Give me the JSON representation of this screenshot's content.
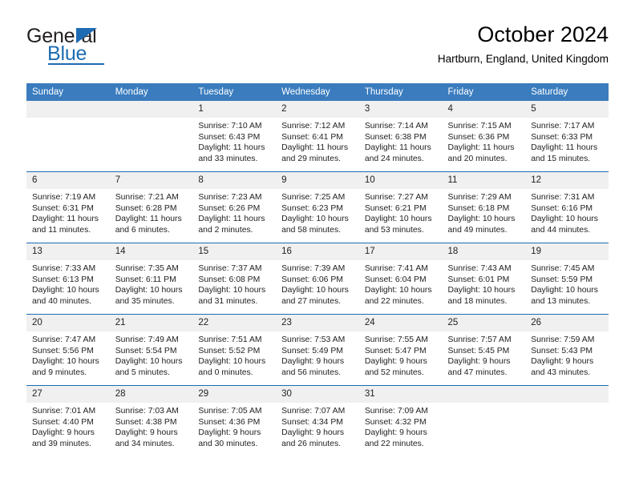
{
  "logo": {
    "text_top": "General",
    "text_bottom": "Blue",
    "accent_color": "#1d6cb3"
  },
  "header": {
    "title": "October 2024",
    "location": "Hartburn, England, United Kingdom"
  },
  "calendar": {
    "header_color": "#3a7cbe",
    "row_divider_color": "#1d6cb3",
    "daynum_background": "#f0f0f0",
    "weekday_headers": [
      "Sunday",
      "Monday",
      "Tuesday",
      "Wednesday",
      "Thursday",
      "Friday",
      "Saturday"
    ],
    "weeks": [
      [
        {
          "day": "",
          "sunrise": "",
          "sunset": "",
          "daylight_line1": "",
          "daylight_line2": ""
        },
        {
          "day": "",
          "sunrise": "",
          "sunset": "",
          "daylight_line1": "",
          "daylight_line2": ""
        },
        {
          "day": "1",
          "sunrise": "Sunrise: 7:10 AM",
          "sunset": "Sunset: 6:43 PM",
          "daylight_line1": "Daylight: 11 hours",
          "daylight_line2": "and 33 minutes."
        },
        {
          "day": "2",
          "sunrise": "Sunrise: 7:12 AM",
          "sunset": "Sunset: 6:41 PM",
          "daylight_line1": "Daylight: 11 hours",
          "daylight_line2": "and 29 minutes."
        },
        {
          "day": "3",
          "sunrise": "Sunrise: 7:14 AM",
          "sunset": "Sunset: 6:38 PM",
          "daylight_line1": "Daylight: 11 hours",
          "daylight_line2": "and 24 minutes."
        },
        {
          "day": "4",
          "sunrise": "Sunrise: 7:15 AM",
          "sunset": "Sunset: 6:36 PM",
          "daylight_line1": "Daylight: 11 hours",
          "daylight_line2": "and 20 minutes."
        },
        {
          "day": "5",
          "sunrise": "Sunrise: 7:17 AM",
          "sunset": "Sunset: 6:33 PM",
          "daylight_line1": "Daylight: 11 hours",
          "daylight_line2": "and 15 minutes."
        }
      ],
      [
        {
          "day": "6",
          "sunrise": "Sunrise: 7:19 AM",
          "sunset": "Sunset: 6:31 PM",
          "daylight_line1": "Daylight: 11 hours",
          "daylight_line2": "and 11 minutes."
        },
        {
          "day": "7",
          "sunrise": "Sunrise: 7:21 AM",
          "sunset": "Sunset: 6:28 PM",
          "daylight_line1": "Daylight: 11 hours",
          "daylight_line2": "and 6 minutes."
        },
        {
          "day": "8",
          "sunrise": "Sunrise: 7:23 AM",
          "sunset": "Sunset: 6:26 PM",
          "daylight_line1": "Daylight: 11 hours",
          "daylight_line2": "and 2 minutes."
        },
        {
          "day": "9",
          "sunrise": "Sunrise: 7:25 AM",
          "sunset": "Sunset: 6:23 PM",
          "daylight_line1": "Daylight: 10 hours",
          "daylight_line2": "and 58 minutes."
        },
        {
          "day": "10",
          "sunrise": "Sunrise: 7:27 AM",
          "sunset": "Sunset: 6:21 PM",
          "daylight_line1": "Daylight: 10 hours",
          "daylight_line2": "and 53 minutes."
        },
        {
          "day": "11",
          "sunrise": "Sunrise: 7:29 AM",
          "sunset": "Sunset: 6:18 PM",
          "daylight_line1": "Daylight: 10 hours",
          "daylight_line2": "and 49 minutes."
        },
        {
          "day": "12",
          "sunrise": "Sunrise: 7:31 AM",
          "sunset": "Sunset: 6:16 PM",
          "daylight_line1": "Daylight: 10 hours",
          "daylight_line2": "and 44 minutes."
        }
      ],
      [
        {
          "day": "13",
          "sunrise": "Sunrise: 7:33 AM",
          "sunset": "Sunset: 6:13 PM",
          "daylight_line1": "Daylight: 10 hours",
          "daylight_line2": "and 40 minutes."
        },
        {
          "day": "14",
          "sunrise": "Sunrise: 7:35 AM",
          "sunset": "Sunset: 6:11 PM",
          "daylight_line1": "Daylight: 10 hours",
          "daylight_line2": "and 35 minutes."
        },
        {
          "day": "15",
          "sunrise": "Sunrise: 7:37 AM",
          "sunset": "Sunset: 6:08 PM",
          "daylight_line1": "Daylight: 10 hours",
          "daylight_line2": "and 31 minutes."
        },
        {
          "day": "16",
          "sunrise": "Sunrise: 7:39 AM",
          "sunset": "Sunset: 6:06 PM",
          "daylight_line1": "Daylight: 10 hours",
          "daylight_line2": "and 27 minutes."
        },
        {
          "day": "17",
          "sunrise": "Sunrise: 7:41 AM",
          "sunset": "Sunset: 6:04 PM",
          "daylight_line1": "Daylight: 10 hours",
          "daylight_line2": "and 22 minutes."
        },
        {
          "day": "18",
          "sunrise": "Sunrise: 7:43 AM",
          "sunset": "Sunset: 6:01 PM",
          "daylight_line1": "Daylight: 10 hours",
          "daylight_line2": "and 18 minutes."
        },
        {
          "day": "19",
          "sunrise": "Sunrise: 7:45 AM",
          "sunset": "Sunset: 5:59 PM",
          "daylight_line1": "Daylight: 10 hours",
          "daylight_line2": "and 13 minutes."
        }
      ],
      [
        {
          "day": "20",
          "sunrise": "Sunrise: 7:47 AM",
          "sunset": "Sunset: 5:56 PM",
          "daylight_line1": "Daylight: 10 hours",
          "daylight_line2": "and 9 minutes."
        },
        {
          "day": "21",
          "sunrise": "Sunrise: 7:49 AM",
          "sunset": "Sunset: 5:54 PM",
          "daylight_line1": "Daylight: 10 hours",
          "daylight_line2": "and 5 minutes."
        },
        {
          "day": "22",
          "sunrise": "Sunrise: 7:51 AM",
          "sunset": "Sunset: 5:52 PM",
          "daylight_line1": "Daylight: 10 hours",
          "daylight_line2": "and 0 minutes."
        },
        {
          "day": "23",
          "sunrise": "Sunrise: 7:53 AM",
          "sunset": "Sunset: 5:49 PM",
          "daylight_line1": "Daylight: 9 hours",
          "daylight_line2": "and 56 minutes."
        },
        {
          "day": "24",
          "sunrise": "Sunrise: 7:55 AM",
          "sunset": "Sunset: 5:47 PM",
          "daylight_line1": "Daylight: 9 hours",
          "daylight_line2": "and 52 minutes."
        },
        {
          "day": "25",
          "sunrise": "Sunrise: 7:57 AM",
          "sunset": "Sunset: 5:45 PM",
          "daylight_line1": "Daylight: 9 hours",
          "daylight_line2": "and 47 minutes."
        },
        {
          "day": "26",
          "sunrise": "Sunrise: 7:59 AM",
          "sunset": "Sunset: 5:43 PM",
          "daylight_line1": "Daylight: 9 hours",
          "daylight_line2": "and 43 minutes."
        }
      ],
      [
        {
          "day": "27",
          "sunrise": "Sunrise: 7:01 AM",
          "sunset": "Sunset: 4:40 PM",
          "daylight_line1": "Daylight: 9 hours",
          "daylight_line2": "and 39 minutes."
        },
        {
          "day": "28",
          "sunrise": "Sunrise: 7:03 AM",
          "sunset": "Sunset: 4:38 PM",
          "daylight_line1": "Daylight: 9 hours",
          "daylight_line2": "and 34 minutes."
        },
        {
          "day": "29",
          "sunrise": "Sunrise: 7:05 AM",
          "sunset": "Sunset: 4:36 PM",
          "daylight_line1": "Daylight: 9 hours",
          "daylight_line2": "and 30 minutes."
        },
        {
          "day": "30",
          "sunrise": "Sunrise: 7:07 AM",
          "sunset": "Sunset: 4:34 PM",
          "daylight_line1": "Daylight: 9 hours",
          "daylight_line2": "and 26 minutes."
        },
        {
          "day": "31",
          "sunrise": "Sunrise: 7:09 AM",
          "sunset": "Sunset: 4:32 PM",
          "daylight_line1": "Daylight: 9 hours",
          "daylight_line2": "and 22 minutes."
        },
        {
          "day": "",
          "sunrise": "",
          "sunset": "",
          "daylight_line1": "",
          "daylight_line2": ""
        },
        {
          "day": "",
          "sunrise": "",
          "sunset": "",
          "daylight_line1": "",
          "daylight_line2": ""
        }
      ]
    ]
  }
}
